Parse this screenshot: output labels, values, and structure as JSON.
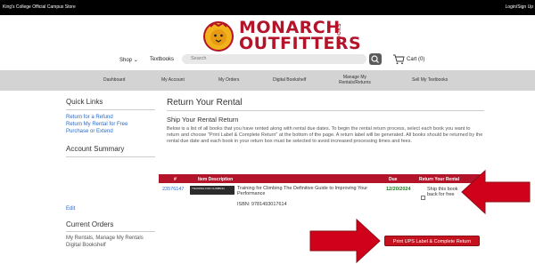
{
  "topbar": {
    "store_name": "King's College Official Campus Store",
    "login": "Login/Sign Up"
  },
  "brand": {
    "line1": "MONARCH",
    "line2": "OUTFITTERS",
    "vertical": "& BOOKS",
    "color": "#b3142a"
  },
  "nav": {
    "shop": "Shop",
    "textbooks": "Textbooks",
    "search_placeholder": "Search",
    "cart": "Cart (0)"
  },
  "menu": [
    {
      "label": "Dashboard"
    },
    {
      "label": "My Account"
    },
    {
      "label": "My Orders"
    },
    {
      "label": "Digital Bookshelf"
    },
    {
      "label": "Manage My",
      "label2": "Rentals/Returns"
    },
    {
      "label": "Sell My Textbooks"
    }
  ],
  "sidebar": {
    "quick_links_title": "Quick Links",
    "links": [
      "Return for a Refund",
      "Return My Rental for Free",
      "Purchase or Extend"
    ],
    "account_summary_title": "Account Summary",
    "edit": "Edit",
    "current_orders_title": "Current Orders",
    "current_orders_text": "My Rentals, Manage My Rentals",
    "current_orders_text2": "Digital Bookshelf"
  },
  "main": {
    "title": "Return Your Rental",
    "subtitle": "Ship Your Rental Return",
    "description": "Below is a list of all books that you have rented along with rental due dates. To begin the rental return process, select each book you want to return and choose \"Print Label & Complete Return\" at the bottom of the page. A return label will be generated. All books should be returned by the rental due date and each book in your return box must be selected to avoid increased processing times and fees."
  },
  "table": {
    "headers": [
      "#",
      "Item Description",
      "Due",
      "Return Your Rental"
    ],
    "rows": [
      {
        "number": "23576147",
        "title": "Training for Climbing The Definitive Guide to Improving Your Performance",
        "isbn": "ISBN: 9781493017614",
        "due": "12/20/2024",
        "ship_label": "Ship this book back for free",
        "thumb_text": "TRAINING FOR CLIMBING"
      }
    ]
  },
  "print_button": "Print UPS Label & Complete Return",
  "colors": {
    "accent": "#c4121f",
    "link": "#2a6ac8",
    "due": "#1f7a1f",
    "menu_bg": "#d3d3d3"
  }
}
